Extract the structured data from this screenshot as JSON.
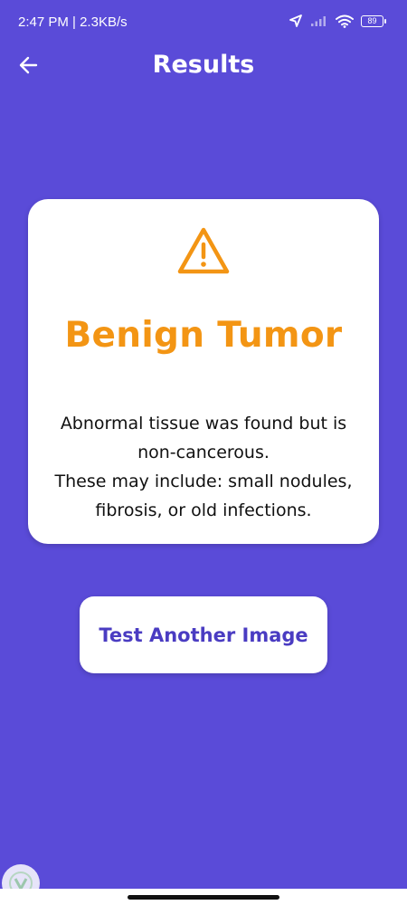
{
  "status_bar": {
    "time": "2:47 PM | 2.3KB/s",
    "battery": "89"
  },
  "header": {
    "title": "Results"
  },
  "result": {
    "title": "Benign Tumor",
    "description": "Abnormal tissue was found but is\nnon-cancerous.\nThese may include: small nodules,\nfibrosis, or old infections.",
    "accent_color": "#f39514"
  },
  "actions": {
    "test_another_label": "Test Another Image"
  },
  "theme": {
    "background": "#5a4bd8",
    "button_text": "#4a3cc2"
  },
  "icons": {
    "back": "arrow-left-icon",
    "warning": "warning-triangle-icon",
    "location": "location-arrow-icon",
    "signal": "signal-icon",
    "wifi": "wifi-icon",
    "battery": "battery-icon"
  }
}
